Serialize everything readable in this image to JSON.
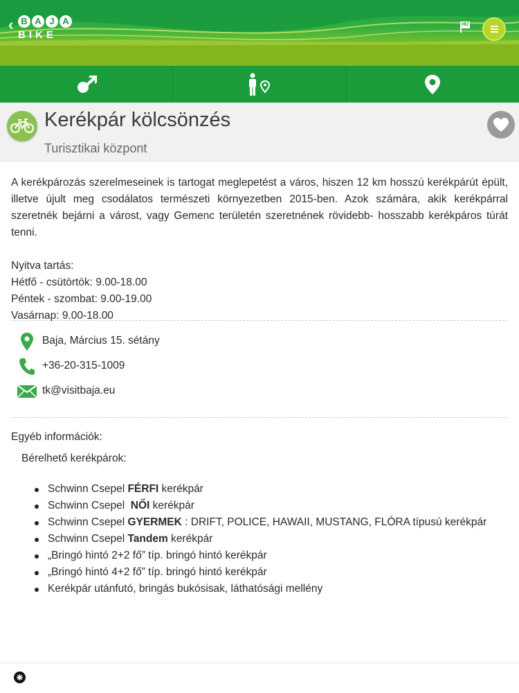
{
  "header": {
    "logo_letters": [
      "B",
      "A",
      "J",
      "A"
    ],
    "logo_sub": "BIKE",
    "language": "HU"
  },
  "nav": {
    "tabs": [
      {
        "icon": "arrow-direction-icon"
      },
      {
        "icon": "person-pin-icon"
      },
      {
        "icon": "map-pin-icon"
      }
    ]
  },
  "poi": {
    "title": "Kerékpár kölcsönzés",
    "subtitle": "Turisztikai központ",
    "category_icon": "bicycle-icon",
    "description": "A kerékpározás szerelmeseinek is tartogat meglepetést a város, hiszen 12 km hosszú kerékpárút épült, illetve újult meg csodálatos természeti környezetben 2015-ben. Azok számára, akik kerékpárral szeretnék bejárni a várost, vagy Gemenc területén szeretnének rövidebb- hosszabb kerékpáros túrát tenni.",
    "hours_title": "Nyitva tartás:",
    "hours": [
      "Hétfő - csütörtök: 9.00-18.00",
      "Péntek - szombat: 9.00-19.00",
      "Vasárnap: 9.00-18.00"
    ]
  },
  "contact": {
    "address": "Baja, Március 15. sétány",
    "phone": "+36-20-315-1009",
    "email": "tk@visitbaja.eu"
  },
  "other": {
    "title": "Egyéb információk:",
    "rentable_title": "Bérelhető kerékpárok:",
    "items": [
      {
        "pre": "Schwinn Csepel ",
        "bold": "FÉRFI",
        "post": " kerékpár"
      },
      {
        "pre": "Schwinn Csepel  ",
        "bold": "NŐI",
        "post": " kerékpár"
      },
      {
        "pre": "Schwinn Csepel ",
        "bold": "GYERMEK",
        "post": " : DRIFT, POLICE, HAWAII, MUSTANG, FLÓRA típusú kerékpár"
      },
      {
        "pre": "Schwinn Csepel ",
        "bold": "Tandem",
        "post": " kerékpár"
      },
      {
        "pre": "„Bringó hintó 2+2 fő” típ. bringó hintó kerékpár",
        "bold": "",
        "post": ""
      },
      {
        "pre": "„Bringó hintó 4+2 fő” típ. bringó hintó kerékpár",
        "bold": "",
        "post": ""
      },
      {
        "pre": "Kerékpár utánfutó, bringás bukósisak, láthatósági mellény",
        "bold": "",
        "post": ""
      }
    ]
  },
  "colors": {
    "header_green": "#1f9c3e",
    "nav_green": "#1a9c3a",
    "lime": "#b8d52a",
    "category_green": "#8cc152",
    "contact_green": "#3aa94a"
  }
}
